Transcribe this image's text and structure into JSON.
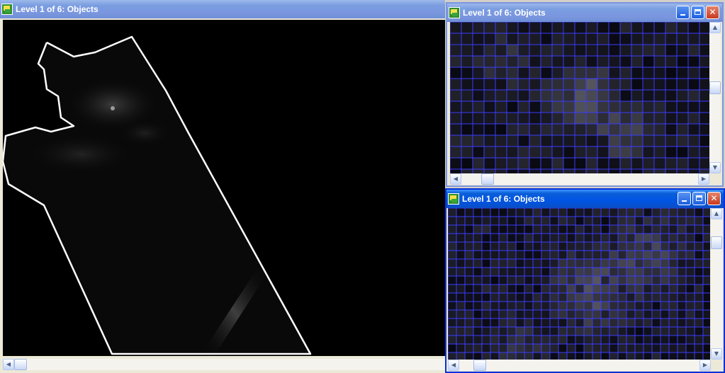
{
  "windows": {
    "main": {
      "title": "Level 1 of 6: Objects"
    },
    "top_right": {
      "title": "Level 1 of 6: Objects"
    },
    "bottom_right": {
      "title": "Level 1 of 6: Objects"
    }
  },
  "icons": {
    "app": "app-icon",
    "minimize": "minimize-icon",
    "maximize": "maximize-icon",
    "close": "close-icon",
    "scroll_left": "arrow-left-icon",
    "scroll_right": "arrow-right-icon",
    "scroll_up": "arrow-up-icon",
    "scroll_down": "arrow-down-icon"
  },
  "colors": {
    "active_title": "#0054e3",
    "inactive_title": "#7a96df",
    "grid_line": "#3a3aff",
    "outline": "#ffffff",
    "close_button": "#c7391c"
  },
  "glyphs": {
    "close": "✕",
    "left": "◀",
    "right": "▶",
    "up": "▲",
    "down": "▼"
  }
}
